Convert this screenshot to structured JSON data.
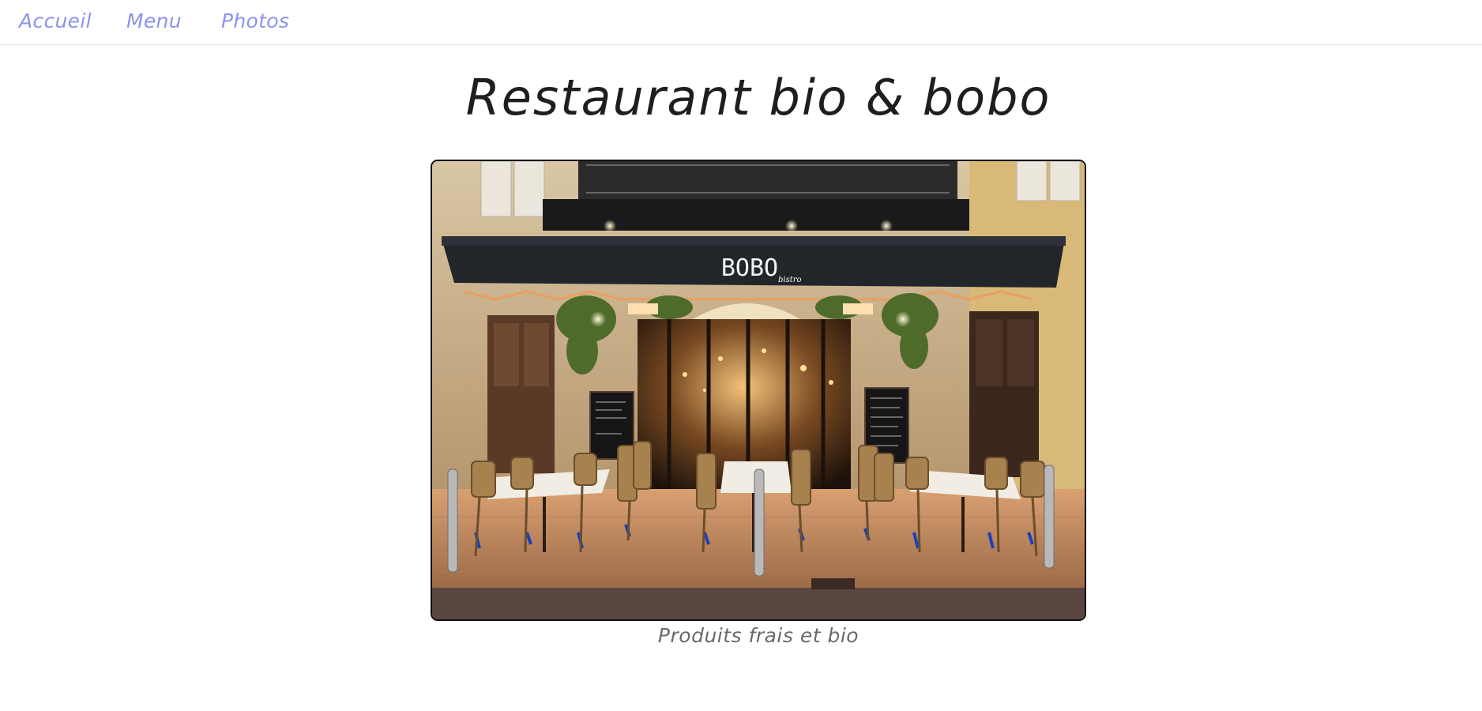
{
  "nav": {
    "items": [
      {
        "label": "Accueil"
      },
      {
        "label": "Menu"
      },
      {
        "label": "Photos"
      }
    ]
  },
  "page": {
    "title": "Restaurant bio & bobo",
    "caption": "Produits frais et bio"
  },
  "photo": {
    "awning_sign": "BOBO",
    "awning_sub": "bistro",
    "depicts": "restaurant-terrace-at-night"
  },
  "colors": {
    "nav_link": "#8c92ee",
    "title": "#1e1e1e",
    "caption": "#6a6a6a",
    "divider": "#e3e3e3"
  }
}
